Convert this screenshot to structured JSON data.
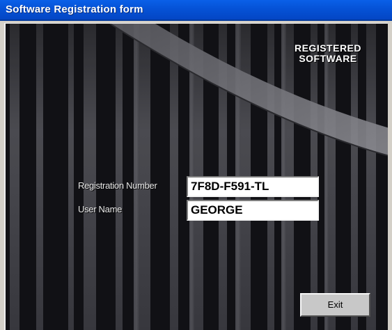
{
  "window": {
    "title": "Software Registration form"
  },
  "stamp": {
    "line1": "REGISTERED",
    "line2": "SOFTWARE"
  },
  "form": {
    "registration_number": {
      "label": "Registration Number",
      "value": "7F8D-F591-TL"
    },
    "user_name": {
      "label": "User Name",
      "value": "GEORGE"
    }
  },
  "buttons": {
    "exit_label": "Exit"
  },
  "colors": {
    "titlebar": "#0552d6",
    "background": "#121216",
    "columns": "#4a4a52"
  }
}
